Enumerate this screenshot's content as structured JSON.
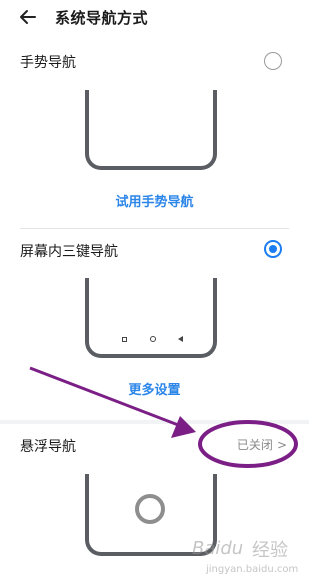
{
  "header": {
    "title": "系统导航方式"
  },
  "gesture": {
    "title": "手势导航",
    "link": "试用手势导航",
    "selected": false
  },
  "three_key": {
    "title": "屏幕内三键导航",
    "link": "更多设置",
    "selected": true
  },
  "floating": {
    "title": "悬浮导航",
    "status": "已关闭",
    "chevron": ">"
  },
  "colors": {
    "accent": "#1a7ef2",
    "annotation": "#7b1e86",
    "phone_frame": "#5a5e63"
  },
  "icons": [
    "back-arrow-icon",
    "radio-icon",
    "nav-square-icon",
    "nav-circle-icon",
    "nav-back-triangle-icon",
    "chevron-right-icon",
    "float-ball-icon"
  ],
  "watermark": {
    "brand": "Baidu",
    "cn": "经验",
    "url": "jingyan.baidu.com"
  }
}
